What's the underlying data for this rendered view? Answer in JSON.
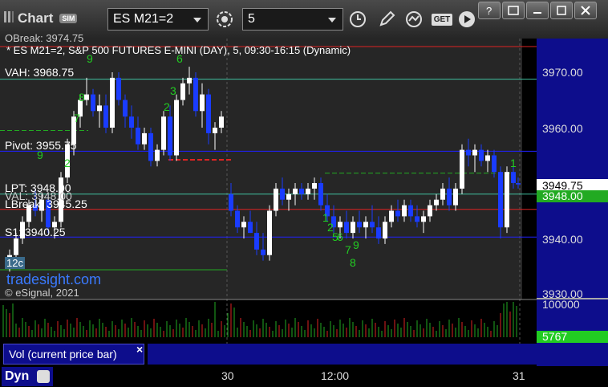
{
  "toolbar": {
    "app_title": "Chart",
    "sim_badge": "SIM",
    "symbol": "ES M21=2",
    "interval": "5",
    "get_label": "GET"
  },
  "chart_header": {
    "top_line": "OBreak: 3974.75",
    "description": "* ES M21=2, S&P 500 FUTURES E-MINI (DAY), 5, 09:30-16:15 (Dynamic)"
  },
  "levels": {
    "vah": "VAH: 3968.75",
    "pivot": "Pivot: 3955.75",
    "lpt": "LPT: 3948.00",
    "val": "VAL: 3948.00",
    "lbreak": "LBreak: 3945.25",
    "s1": "S1: 3940.25"
  },
  "watermark": {
    "site": "tradesight.com",
    "copyright": "© eSignal, 2021",
    "badge": "12c"
  },
  "price_axis": {
    "ticks": [
      "3970.00",
      "3960.00",
      "3950.00",
      "3940.00",
      "3930.00"
    ],
    "last_price": "3949.75",
    "level_tag": "3948.00"
  },
  "volume": {
    "label": "Vol (current price bar)",
    "axis_max": "100000",
    "last_value": "5767"
  },
  "time_axis": [
    "30",
    "12:00",
    "31"
  ],
  "footer": {
    "dyn_label": "Dyn"
  },
  "colors": {
    "up_candle": "#ffffff",
    "down_candle": "#1a3cff",
    "vah_line": "#40c0a0",
    "pivot_line": "#2020ff",
    "lbreak_line": "#dd2222",
    "axis_bg": "#0d0d8c",
    "tag_green": "#22aa22"
  }
}
